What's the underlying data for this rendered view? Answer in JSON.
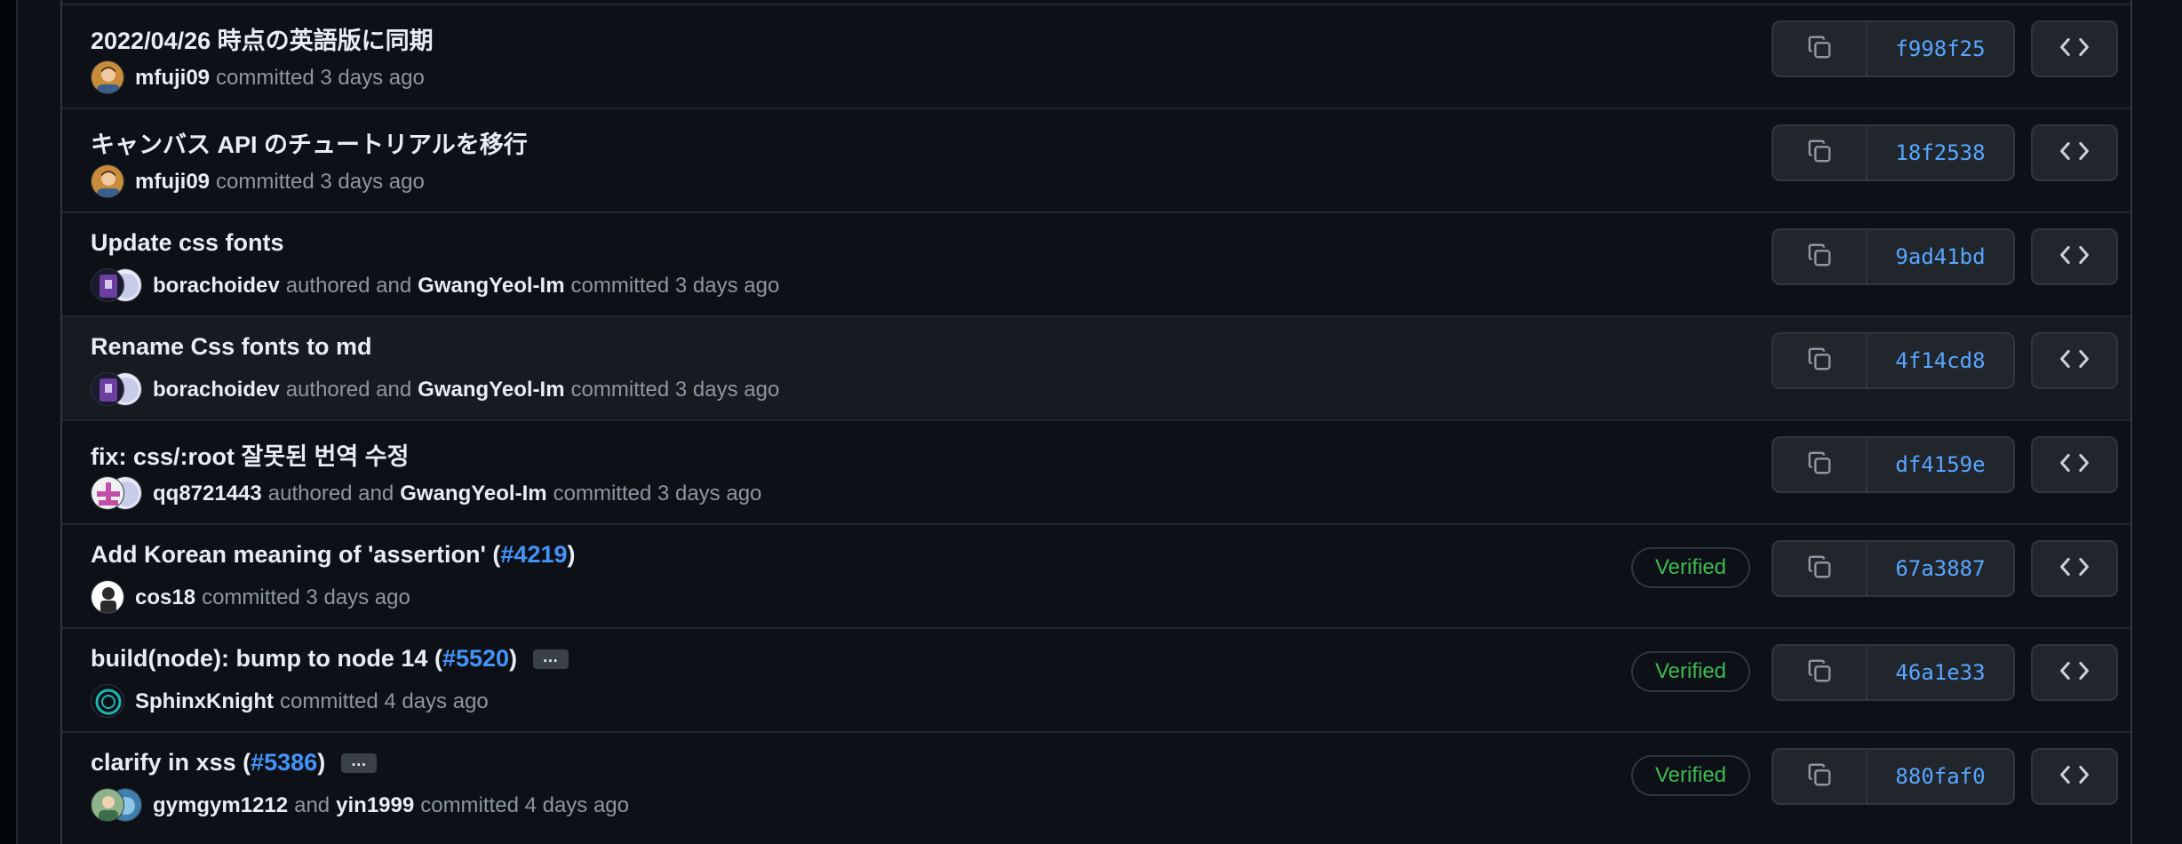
{
  "commits": [
    {
      "title": "2022/04/26 時点の英語版に同期",
      "pr": "",
      "pr_suffix": "",
      "has_ellipsis": false,
      "avatars": [
        "mfuji"
      ],
      "user1": "mfuji09",
      "connector": "",
      "user2": "",
      "trail": "committed 3 days ago",
      "verified": "",
      "sha": "f998f25",
      "hover": false
    },
    {
      "title": "キャンバス API のチュートリアルを移行",
      "pr": "",
      "pr_suffix": "",
      "has_ellipsis": false,
      "avatars": [
        "mfuji"
      ],
      "user1": "mfuji09",
      "connector": "",
      "user2": "",
      "trail": "committed 3 days ago",
      "verified": "",
      "sha": "18f2538",
      "hover": false
    },
    {
      "title": "Update css fonts",
      "pr": "",
      "pr_suffix": "",
      "has_ellipsis": false,
      "avatars": [
        "boracho",
        "gwang"
      ],
      "user1": "borachoidev",
      "connector": "authored and",
      "user2": "GwangYeol-Im",
      "trail": "committed 3 days ago",
      "verified": "",
      "sha": "9ad41bd",
      "hover": false
    },
    {
      "title": "Rename Css fonts to md",
      "pr": "",
      "pr_suffix": "",
      "has_ellipsis": false,
      "avatars": [
        "boracho",
        "gwang"
      ],
      "user1": "borachoidev",
      "connector": "authored and",
      "user2": "GwangYeol-Im",
      "trail": "committed 3 days ago",
      "verified": "",
      "sha": "4f14cd8",
      "hover": true
    },
    {
      "title": "fix: css/:root 잘못된 번역 수정",
      "pr": "",
      "pr_suffix": "",
      "has_ellipsis": false,
      "avatars": [
        "qq",
        "gwang"
      ],
      "user1": "qq8721443",
      "connector": "authored and",
      "user2": "GwangYeol-Im",
      "trail": "committed 3 days ago",
      "verified": "",
      "sha": "df4159e",
      "hover": false
    },
    {
      "title": "Add Korean meaning of 'assertion' (",
      "pr": "#4219",
      "pr_suffix": ")",
      "has_ellipsis": false,
      "avatars": [
        "cos"
      ],
      "user1": "cos18",
      "connector": "",
      "user2": "",
      "trail": "committed 3 days ago",
      "verified": "Verified",
      "sha": "67a3887",
      "hover": false
    },
    {
      "title": "build(node): bump to node 14 (",
      "pr": "#5520",
      "pr_suffix": ")",
      "has_ellipsis": true,
      "avatars": [
        "sphinx"
      ],
      "user1": "SphinxKnight",
      "connector": "",
      "user2": "",
      "trail": "committed 4 days ago",
      "verified": "Verified",
      "sha": "46a1e33",
      "hover": false
    },
    {
      "title": "clarify in xss (",
      "pr": "#5386",
      "pr_suffix": ")",
      "has_ellipsis": true,
      "avatars": [
        "gym",
        "yin"
      ],
      "user1": "gymgym1212",
      "connector": "and",
      "user2": "yin1999",
      "trail": "committed 4 days ago",
      "verified": "Verified",
      "sha": "880faf0",
      "hover": false
    }
  ],
  "ellipsis_label": "…",
  "icons": {
    "copy": "copy-icon",
    "code": "code-icon"
  }
}
